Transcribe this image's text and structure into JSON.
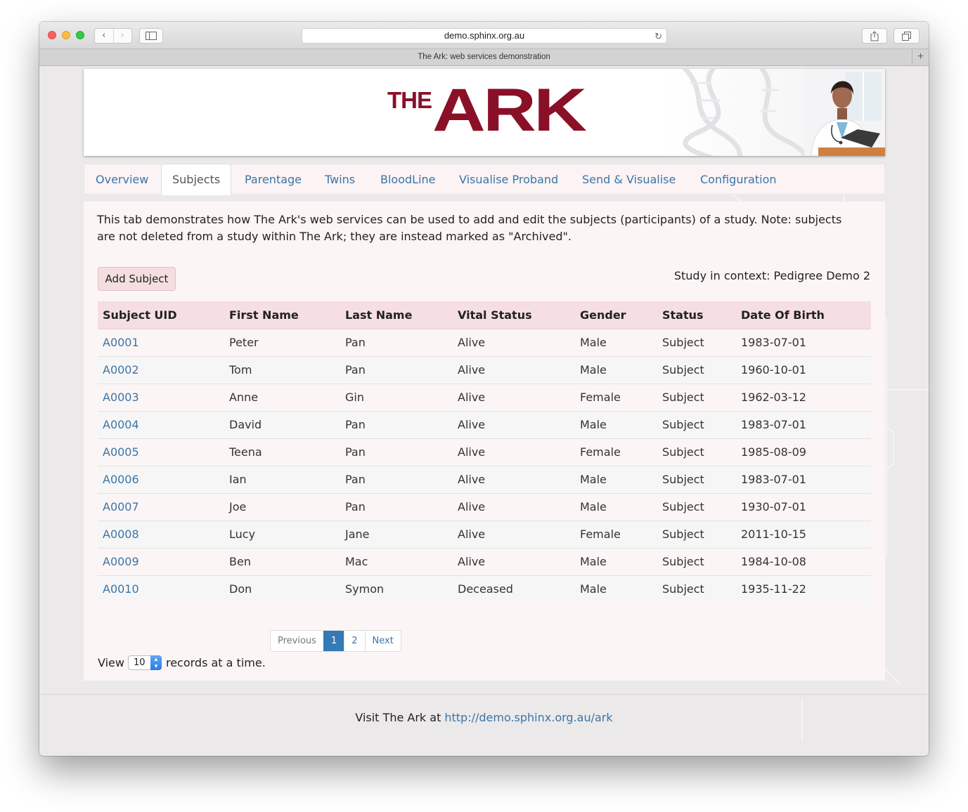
{
  "browser": {
    "url": "demo.sphinx.org.au",
    "tab_title": "The Ark: web services demonstration"
  },
  "banner": {
    "logo_small": "THE",
    "logo_large": "ARK",
    "brand_color": "#8a1028"
  },
  "nav": {
    "tabs": [
      {
        "label": "Overview"
      },
      {
        "label": "Subjects"
      },
      {
        "label": "Parentage"
      },
      {
        "label": "Twins"
      },
      {
        "label": "BloodLine"
      },
      {
        "label": "Visualise Proband"
      },
      {
        "label": "Send & Visualise"
      },
      {
        "label": "Configuration"
      }
    ],
    "active": "Subjects"
  },
  "content": {
    "intro": "This tab demonstrates how The Ark's web services can be used to add and edit the subjects (participants) of a study. Note: subjects are not deleted from a study within The Ark; they are instead marked as \"Archived\".",
    "add_button": "Add Subject",
    "context_label": "Study in context:",
    "context_value": "Pedigree Demo 2"
  },
  "table": {
    "headers": [
      "Subject UID",
      "First Name",
      "Last Name",
      "Vital Status",
      "Gender",
      "Status",
      "Date Of Birth"
    ],
    "rows": [
      [
        "A0001",
        "Peter",
        "Pan",
        "Alive",
        "Male",
        "Subject",
        "1983-07-01"
      ],
      [
        "A0002",
        "Tom",
        "Pan",
        "Alive",
        "Male",
        "Subject",
        "1960-10-01"
      ],
      [
        "A0003",
        "Anne",
        "Gin",
        "Alive",
        "Female",
        "Subject",
        "1962-03-12"
      ],
      [
        "A0004",
        "David",
        "Pan",
        "Alive",
        "Male",
        "Subject",
        "1983-07-01"
      ],
      [
        "A0005",
        "Teena",
        "Pan",
        "Alive",
        "Female",
        "Subject",
        "1985-08-09"
      ],
      [
        "A0006",
        "Ian",
        "Pan",
        "Alive",
        "Male",
        "Subject",
        "1983-07-01"
      ],
      [
        "A0007",
        "Joe",
        "Pan",
        "Alive",
        "Male",
        "Subject",
        "1930-07-01"
      ],
      [
        "A0008",
        "Lucy",
        "Jane",
        "Alive",
        "Female",
        "Subject",
        "2011-10-15"
      ],
      [
        "A0009",
        "Ben",
        "Mac",
        "Alive",
        "Male",
        "Subject",
        "1984-10-08"
      ],
      [
        "A0010",
        "Don",
        "Symon",
        "Deceased",
        "Male",
        "Subject",
        "1935-11-22"
      ]
    ]
  },
  "pagination": {
    "previous": "Previous",
    "pages": [
      "1",
      "2"
    ],
    "current_page": "1",
    "next": "Next"
  },
  "page_size": {
    "prefix": "View",
    "value": "10",
    "suffix": "records at a time."
  },
  "footer": {
    "text": "Visit The Ark at",
    "link": "http://demo.sphinx.org.au/ark"
  },
  "colors": {
    "link": "#3b75a8",
    "table_header_bg": "#f5dfe2",
    "panel_bg": "#fcf5f5",
    "active_page": "#337ab7"
  }
}
